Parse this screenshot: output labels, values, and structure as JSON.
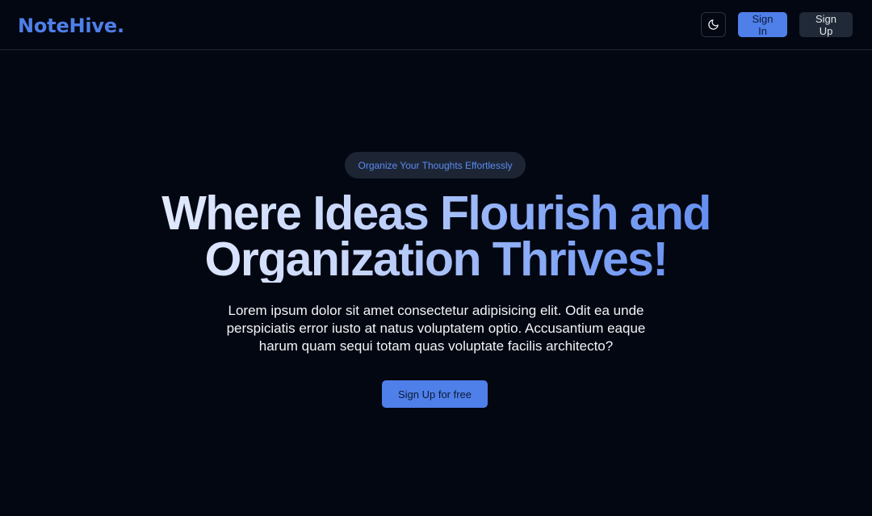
{
  "header": {
    "logo": "NoteHive.",
    "theme_toggle_icon": "moon-icon",
    "sign_in_label": "Sign In",
    "sign_up_label": "Sign Up"
  },
  "hero": {
    "badge": "Organize Your Thoughts Effortlessly",
    "headline_line1": "Where Ideas Flourish and",
    "headline_line2": "Organization Thrives!",
    "description": "Lorem ipsum dolor sit amet consectetur adipisicing elit. Odit ea unde perspiciatis error iusto at natus voluptatem optio. Accusantium eaque harum quam sequi totam quas voluptate facilis architecto?",
    "cta_label": "Sign Up for free"
  },
  "colors": {
    "background": "#030712",
    "accent": "#4f7fe8",
    "secondary_button": "#1f2937",
    "badge_background": "#1d2535",
    "badge_text": "#5b8cf0",
    "gradient_start": "#e8eefc",
    "gradient_end": "#5b87ee"
  }
}
